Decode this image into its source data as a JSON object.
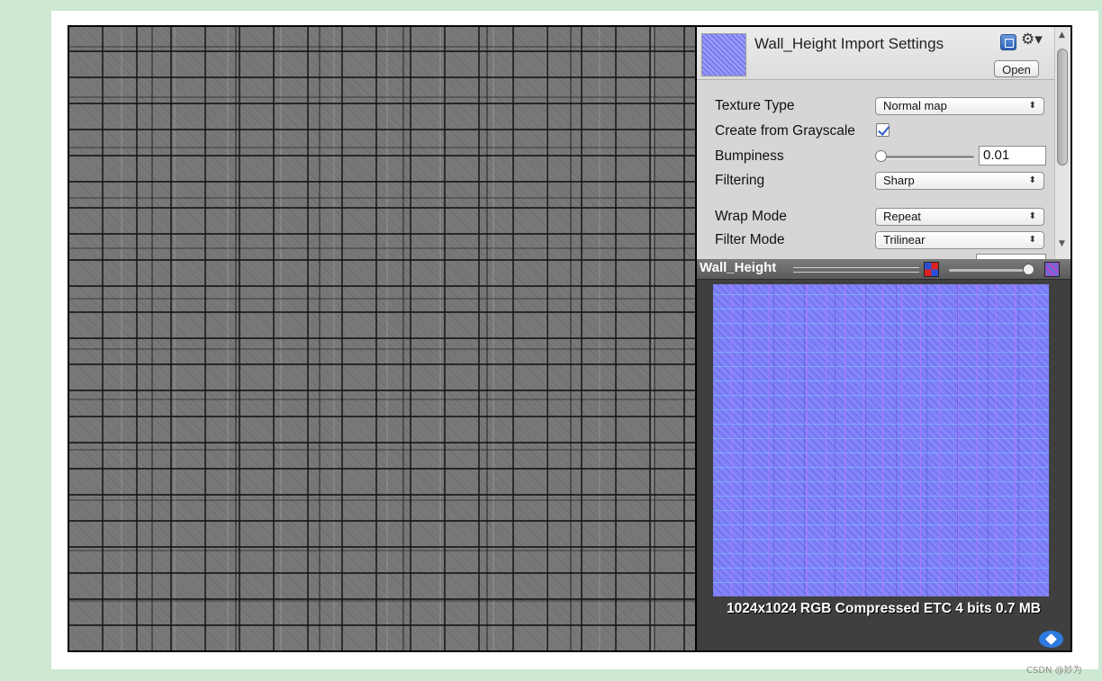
{
  "inspector": {
    "title": "Wall_Height Import Settings",
    "open_label": "Open",
    "rows": {
      "texture_type": {
        "label": "Texture Type",
        "value": "Normal map"
      },
      "grayscale": {
        "label": "Create from Grayscale",
        "checked": true
      },
      "bumpiness": {
        "label": "Bumpiness",
        "value": "0.01"
      },
      "filtering": {
        "label": "Filtering",
        "value": "Sharp"
      },
      "wrap_mode": {
        "label": "Wrap Mode",
        "value": "Repeat"
      },
      "filter_mode": {
        "label": "Filter Mode",
        "value": "Trilinear"
      }
    }
  },
  "preview": {
    "title": "Wall_Height",
    "info": "1024x1024  RGB Compressed ETC 4 bits   0.7 MB"
  },
  "watermark": "CSDN @妙为",
  "icons": [
    "help-icon",
    "gear-icon",
    "rgb-channel-icon",
    "alpha-channel-icon",
    "asset-label-icon",
    "scroll-up-icon",
    "scroll-down-icon",
    "popup-arrows-icon"
  ],
  "colors": {
    "background": "#cde8d3",
    "inspector_bg": "#d6d6d6",
    "preview_bg": "#3f3f3f",
    "normal_map": "#7e7ff5",
    "height_map": "#787878",
    "label_icon": "#2e7be0"
  }
}
